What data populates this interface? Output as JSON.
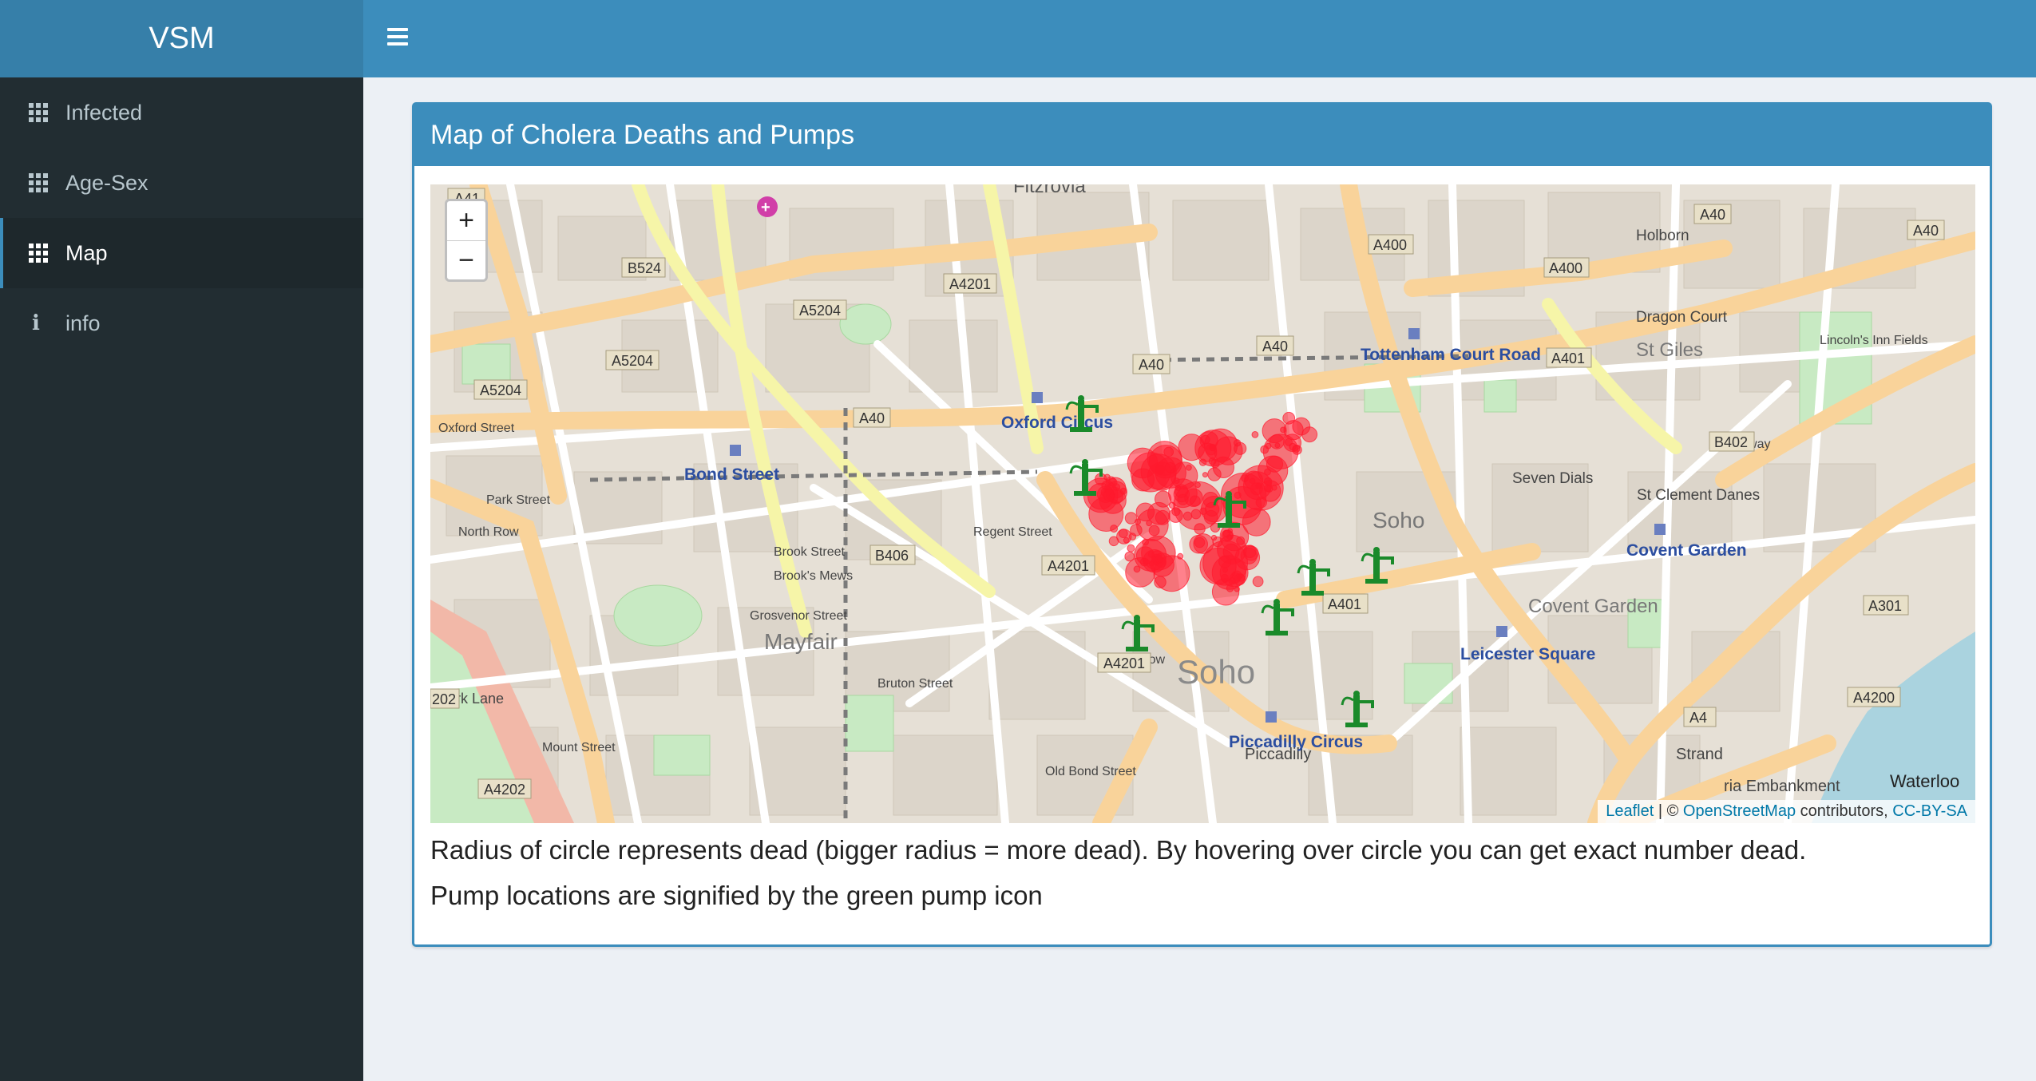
{
  "app": {
    "title": "VSM"
  },
  "sidebar": {
    "items": [
      {
        "label": "Infected",
        "icon": "grid-icon"
      },
      {
        "label": "Age-Sex",
        "icon": "grid-icon"
      },
      {
        "label": "Map",
        "icon": "grid-icon",
        "active": true
      },
      {
        "label": "info",
        "icon": "info-icon"
      }
    ]
  },
  "box": {
    "title": "Map of Cholera Deaths and Pumps"
  },
  "map": {
    "zoom_in": "+",
    "zoom_out": "−",
    "attribution": {
      "leaflet": "Leaflet",
      "separator": " | © ",
      "osm": "OpenStreetMap",
      "contributors": " contributors, ",
      "license": "CC-BY-SA"
    },
    "labels": {
      "fitzrovia": "Fitzrovia",
      "a41": "A41",
      "b524": "B524",
      "a4201_top": "A4201",
      "a5204_1": "A5204",
      "a5204_2": "A5204",
      "a5204_3": "A5204",
      "a40_1": "A40",
      "a40_2": "A40",
      "a40_3": "A40",
      "a40_4": "A40",
      "a400_1": "A400",
      "a400_2": "A400",
      "a40_right": "A40",
      "a401_top": "A401",
      "holborn": "Holborn",
      "dragon_court": "Dragon Court",
      "st_giles": "St Giles",
      "kingsway": "Kingsway",
      "lincolns_inn": "Lincoln's Inn Fields",
      "oxford_circus": "Oxford Circus",
      "tottenham": "Tottenham Court Road",
      "bond_street": "Bond Street",
      "soho": "Soho",
      "soho_small": "Soho",
      "seven_dials": "Seven Dials",
      "b402": "B402",
      "st_clement": "St Clement Danes",
      "north_row": "North Row",
      "brook_street": "Brook Street",
      "brooks_mews": "Brook's Mews",
      "b406": "B406",
      "a4201_mid": "A4201",
      "a401": "A401",
      "covent_garden_stn": "Covent Garden",
      "covent_garden": "Covent Garden",
      "strand": "Strand",
      "a301": "A301",
      "mayfair": "Mayfair",
      "grosvenor_street": "Grosvenor Street",
      "a4201_low": "A4201",
      "leicester_square": "Leicester Square",
      "a4": "A4",
      "a4200": "A4200",
      "piccadilly_circus": "Piccadilly Circus",
      "piccadilly": "Piccadilly",
      "park_lane": "Park Lane",
      "a4202": "A4202",
      "a202": "202",
      "waterloo": "Waterloo",
      "embankment": "ria Embankment",
      "mount_street": "Mount Street",
      "park_street": "Park Street",
      "bruton_street": "Bruton Street",
      "old_bond_street": "Old Bond Street",
      "savile_row": "Savile Row",
      "regent_street": "Regent Street",
      "oxford_street": "Oxford Street"
    }
  },
  "captions": {
    "line1": "Radius of circle represents dead (bigger radius = more dead). By hovering over circle you can get exact number dead.",
    "line2": "Pump locations are signified by the green pump icon"
  },
  "colors": {
    "header": "#3c8dbc",
    "logo_bg": "#367fa9",
    "sidebar": "#222d32",
    "death_circle": "#ff1a2e",
    "pump": "#1a8a2a"
  }
}
